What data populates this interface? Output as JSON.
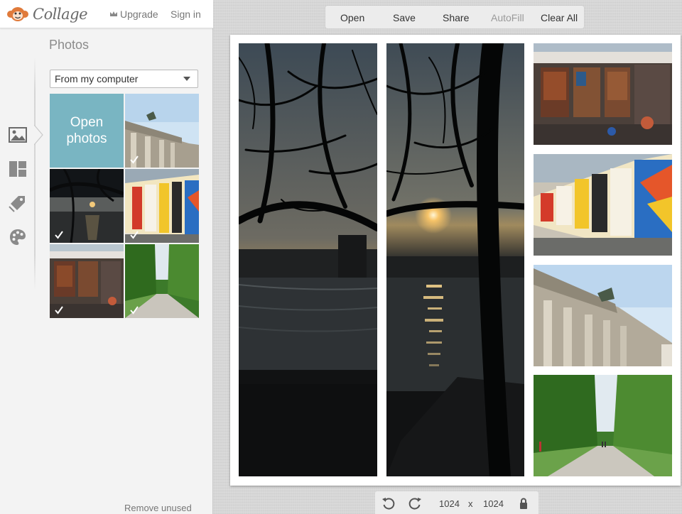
{
  "header": {
    "logo_text": "Collage",
    "upgrade_label": "Upgrade",
    "signin_label": "Sign in"
  },
  "sidebar": {
    "rail": [
      {
        "name": "photos-icon",
        "active": true
      },
      {
        "name": "layouts-icon",
        "active": false
      },
      {
        "name": "stickers-icon",
        "active": false
      },
      {
        "name": "palette-icon",
        "active": false
      }
    ]
  },
  "photos_panel": {
    "title": "Photos",
    "source_selected": "From my computer",
    "open_photos_label": "Open\nphotos",
    "remove_unused_label": "Remove unused"
  },
  "toolbar": {
    "open": "Open",
    "save": "Save",
    "share": "Share",
    "autofill": "AutoFill",
    "clear_all": "Clear All"
  },
  "bottom": {
    "width": "1024",
    "x_sep": "x",
    "height": "1024"
  },
  "colors": {
    "accent_teal": "#79b5c2",
    "logo_orange": "#e07a3a"
  }
}
